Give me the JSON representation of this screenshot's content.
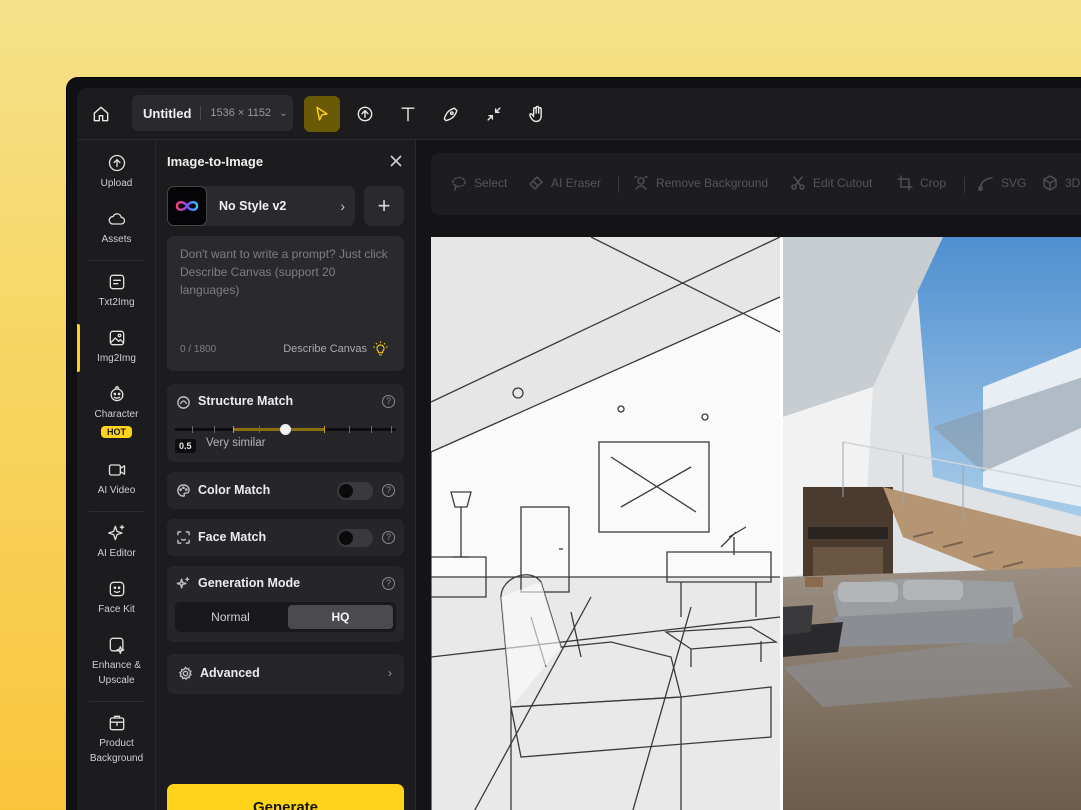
{
  "topbar": {
    "doc_title": "Untitled",
    "doc_size": "1536 × 1152",
    "tools": [
      "home-icon",
      "select-arrow-icon",
      "upload-icon",
      "text-icon",
      "pen-icon",
      "collapse-icon",
      "hand-icon"
    ],
    "active_tool": "select-arrow-icon"
  },
  "rail": {
    "items": [
      {
        "label": "Upload",
        "icon": "upload-icon"
      },
      {
        "label": "Assets",
        "icon": "cloud-icon"
      },
      {
        "label": "Txt2Img",
        "icon": "txt2img-icon"
      },
      {
        "label": "Img2Img",
        "icon": "img2img-icon"
      },
      {
        "label": "Character",
        "icon": "character-icon",
        "badge": "HOT"
      },
      {
        "label": "AI Video",
        "icon": "video-icon"
      },
      {
        "label": "AI Editor",
        "icon": "sparkle-icon"
      },
      {
        "label": "Face Kit",
        "icon": "face-kit-icon"
      },
      {
        "label": "Enhance & Upscale",
        "icon": "enhance-icon"
      },
      {
        "label": "Product Background",
        "icon": "product-icon"
      }
    ],
    "active": "Img2Img"
  },
  "panel": {
    "title": "Image-to-Image",
    "style_name": "No Style v2",
    "prompt_placeholder": "Don't want to write a prompt? Just click Describe Canvas (support 20 languages)",
    "prompt_count": "0 / 1800",
    "describe_label": "Describe Canvas",
    "structure_match": {
      "label": "Structure Match",
      "value": "0.5",
      "value_fraction": 0.5,
      "description": "Very similar"
    },
    "color_match": {
      "label": "Color Match",
      "enabled": false
    },
    "face_match": {
      "label": "Face Match",
      "enabled": false
    },
    "generation_mode": {
      "label": "Generation Mode",
      "options": [
        "Normal",
        "HQ"
      ],
      "selected": "HQ"
    },
    "advanced_label": "Advanced",
    "generate_label": "Generate"
  },
  "canvas_tools": [
    {
      "label": "Select",
      "icon": "lasso-icon"
    },
    {
      "label": "AI Eraser",
      "icon": "eraser-icon"
    },
    {
      "label": "Remove Background",
      "icon": "remove-bg-icon"
    },
    {
      "label": "Edit Cutout",
      "icon": "scissors-icon"
    },
    {
      "label": "Crop",
      "icon": "crop-icon"
    },
    {
      "label": "SVG",
      "icon": "svg-curve-icon"
    },
    {
      "label": "3D",
      "icon": "cube-icon"
    }
  ],
  "colors": {
    "accent": "#ffd319",
    "panel_bg": "#1c1c1f",
    "card_bg": "#26262a"
  }
}
